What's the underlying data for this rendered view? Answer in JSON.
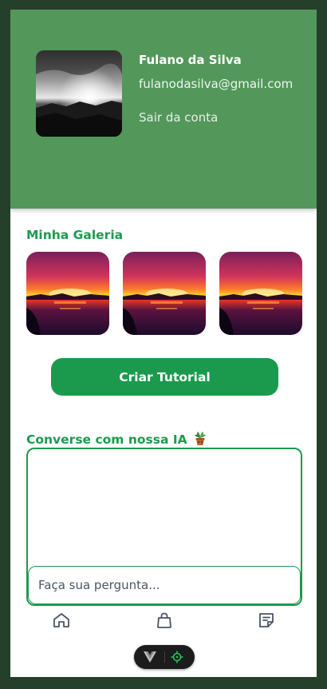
{
  "profile": {
    "name": "Fulano da Silva",
    "email": "fulanodasilva@gmail.com",
    "logout_label": "Sair da conta",
    "avatar_icon": "landscape-photo-bw"
  },
  "gallery": {
    "title": "Minha Galeria",
    "items": [
      {
        "icon": "sunset-photo"
      },
      {
        "icon": "sunset-photo"
      },
      {
        "icon": "sunset-photo"
      }
    ]
  },
  "create_button_label": "Criar Tutorial",
  "chat": {
    "title": "Converse com nossa IA",
    "title_icon": "potted-plant-icon",
    "placeholder": "Faça sua pergunta..."
  },
  "nav": {
    "items": [
      {
        "icon": "home-icon"
      },
      {
        "icon": "shopping-bag-icon"
      },
      {
        "icon": "notes-icon"
      }
    ]
  },
  "colors": {
    "header_bg": "#53975b",
    "accent": "#1e9a4e",
    "frame_bg": "#243f2a"
  }
}
